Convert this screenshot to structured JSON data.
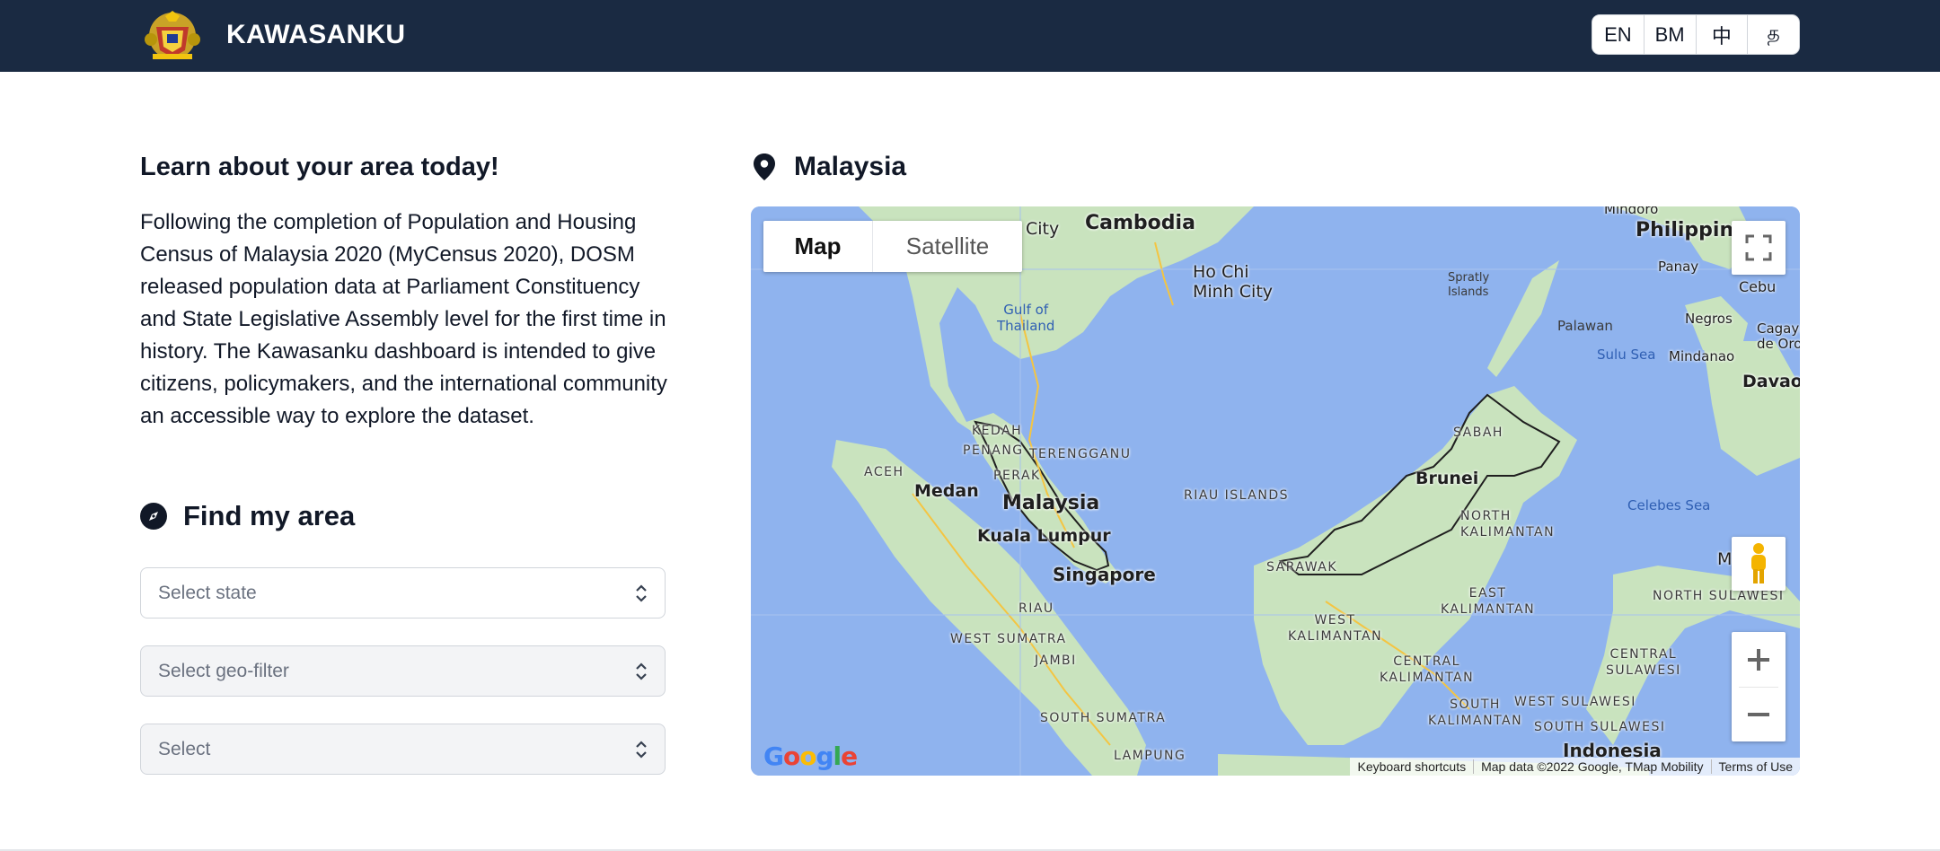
{
  "header": {
    "brand": "KAWASANKU",
    "languages": [
      {
        "label": "EN",
        "active": true
      },
      {
        "label": "BM",
        "active": false
      },
      {
        "label": "中",
        "active": false
      },
      {
        "label": "த",
        "active": false
      }
    ]
  },
  "intro": {
    "title": "Learn about your area today!",
    "body": "Following the completion of Population and Housing Census of Malaysia 2020 (MyCensus 2020), DOSM released population data at Parliament Constituency and State Legislative Assembly level for the first time in history. The Kawasanku dashboard is intended to give citizens, policymakers, and the international community an accessible way to explore the dataset."
  },
  "find_area": {
    "title": "Find my area",
    "selects": [
      {
        "placeholder": "Select state",
        "enabled": true
      },
      {
        "placeholder": "Select geo-filter",
        "enabled": false
      },
      {
        "placeholder": "Select",
        "enabled": false
      }
    ]
  },
  "map": {
    "title": "Malaysia",
    "type_buttons": {
      "map": "Map",
      "satellite": "Satellite"
    },
    "labels": {
      "cambodia": "Cambodia",
      "city_partial": "City",
      "ho_chi_minh": "Ho Chi\nMinh City",
      "philippines": "Philippine",
      "mindoro": "Mindoro",
      "panay": "Panay",
      "cebu": "Cebu",
      "negros": "Negros",
      "cagayan": "Cagayan\nde Oro",
      "mindanao": "Mindanao",
      "davao": "Davao",
      "palawan": "Palawan",
      "spratly": "Spratly\nIslands",
      "gulf_thailand": "Gulf of\nThailand",
      "sulu_sea": "Sulu Sea",
      "celebes_sea": "Celebes Sea",
      "kedah": "KEDAH",
      "penang": "PENANG",
      "perak": "PERAK",
      "terengganu": "TERENGGANU",
      "aceh": "ACEH",
      "medan": "Medan",
      "malaysia": "Malaysia",
      "kuala_lumpur": "Kuala Lumpur",
      "singapore": "Singapore",
      "riau_islands": "RIAU ISLANDS",
      "riau": "RIAU",
      "west_sumatra": "WEST SUMATRA",
      "jambi": "JAMBI",
      "south_sumatra": "SOUTH SUMATRA",
      "lampung": "LAMPUNG",
      "sabah": "SABAH",
      "brunei": "Brunei",
      "north_kalimantan": "NORTH\nKALIMANTAN",
      "sarawak": "SARAWAK",
      "east_kalimantan": "EAST\nKALIMANTAN",
      "west_kalimantan": "WEST\nKALIMANTAN",
      "central_kalimantan": "CENTRAL\nKALIMANTAN",
      "south_kalimantan": "SOUTH\nKALIMANTAN",
      "north_sulawesi": "NORTH SULAWESI",
      "central_sulawesi": "CENTRAL\nSULAWESI",
      "west_sulawesi": "WEST SULAWESI",
      "south_sulawesi": "SOUTH SULAWESI",
      "indonesia": "Indonesia",
      "m_partial": "M"
    },
    "google": "Google",
    "attribution": {
      "shortcuts": "Keyboard shortcuts",
      "data": "Map data ©2022 Google, TMap Mobility",
      "terms": "Terms of Use"
    }
  },
  "colors": {
    "header_bg": "#1a2a42",
    "water": "#8fb3ee",
    "land": "#c9e3be",
    "border": "#1f1f1f"
  }
}
